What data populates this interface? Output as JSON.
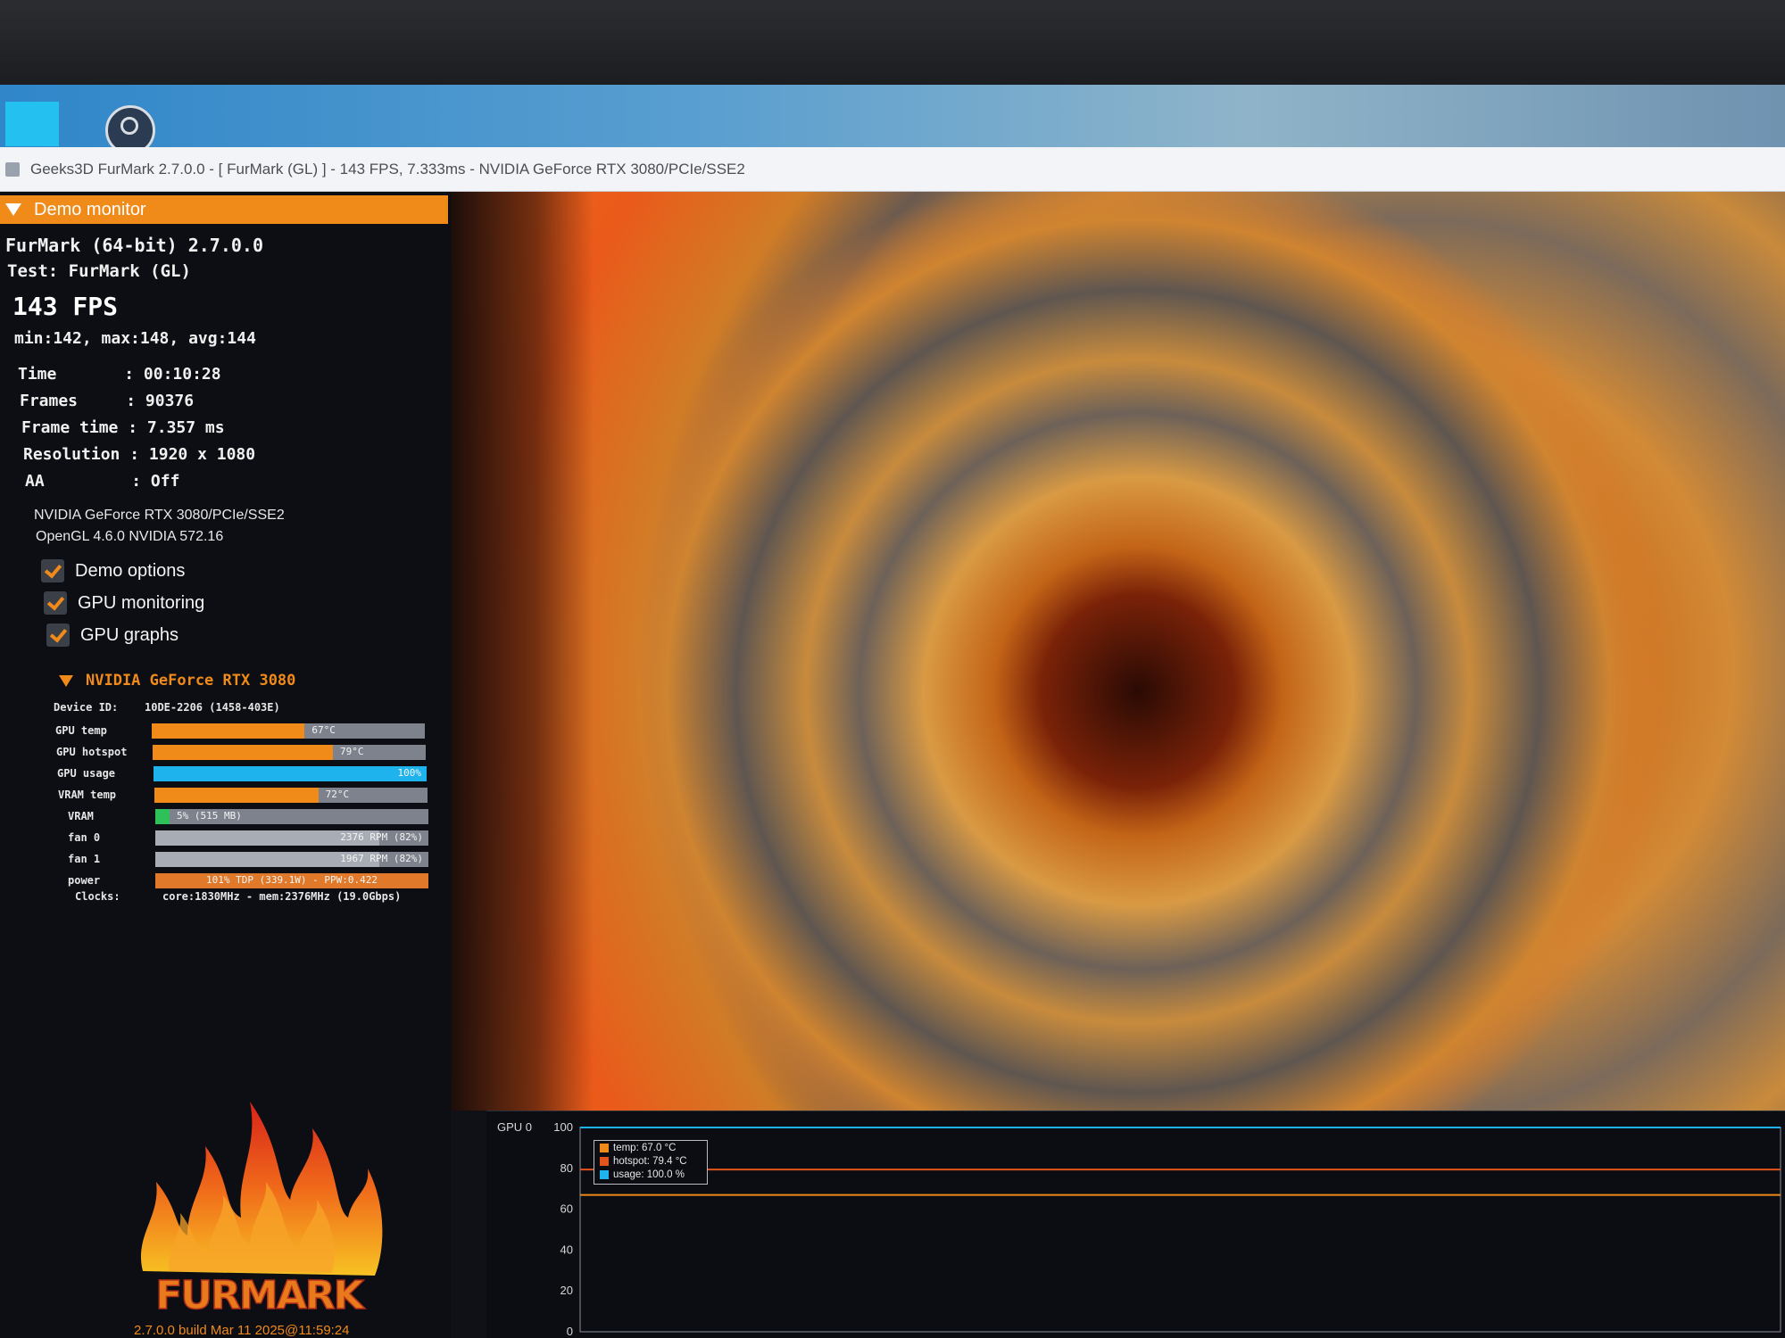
{
  "window": {
    "title": "Geeks3D FurMark 2.7.0.0 - [ FurMark (GL) ] - 143 FPS, 7.333ms - NVIDIA GeForce RTX 3080/PCIe/SSE2"
  },
  "panel": {
    "header": "Demo monitor",
    "app_line": "FurMark (64-bit) 2.7.0.0",
    "test_line": "Test: FurMark (GL)",
    "fps": "143 FPS",
    "fps_stats": "min:142, max:148, avg:144",
    "stats": [
      {
        "label": "Time      ",
        "value": ": 00:10:28"
      },
      {
        "label": "Frames    ",
        "value": ": 90376"
      },
      {
        "label": "Frame time",
        "value": ": 7.357 ms"
      },
      {
        "label": "Resolution",
        "value": ": 1920 x 1080"
      },
      {
        "label": "AA        ",
        "value": ": Off"
      }
    ],
    "gpu_renderer": "NVIDIA GeForce RTX 3080/PCIe/SSE2",
    "gl_version": "OpenGL 4.6.0 NVIDIA 572.16",
    "checkboxes": [
      {
        "label": "Demo options",
        "checked": true
      },
      {
        "label": "GPU monitoring",
        "checked": true
      },
      {
        "label": "GPU graphs",
        "checked": true
      }
    ],
    "gpu_name": "NVIDIA GeForce RTX 3080",
    "device_label": "Device ID:",
    "device_id": "10DE-2206 (1458-403E)",
    "metrics": [
      {
        "key": "GPU temp",
        "text": "67°C",
        "fill": 0.56,
        "color": "#f08a19"
      },
      {
        "key": "GPU hotspot",
        "text": "79°C",
        "fill": 0.66,
        "color": "#f08a19"
      },
      {
        "key": "GPU usage",
        "text": "100%",
        "fill": 1.0,
        "color": "#1fb3ee"
      },
      {
        "key": "VRAM temp",
        "text": "72°C",
        "fill": 0.6,
        "color": "#f08a19"
      },
      {
        "key": "VRAM",
        "text": "5% (515 MB)",
        "fill": 0.05,
        "color": "#2ec15a"
      },
      {
        "key": "fan 0",
        "text": "2376 RPM (82%)",
        "fill": 0.82,
        "color": "#a8adb5"
      },
      {
        "key": "fan 1",
        "text": "1967 RPM (82%)",
        "fill": 0.82,
        "color": "#a8adb5"
      },
      {
        "key": "power",
        "text": "101% TDP (339.1W) - PPW:0.422",
        "fill": 1.0,
        "color": "#e07a2a"
      }
    ],
    "clocks_label": "Clocks:",
    "clocks_value": "core:1830MHz - mem:2376MHz (19.0Gbps)",
    "logo_text": "FURMARK",
    "build": "2.7.0.0 build Mar 11 2025@11:59:24"
  },
  "graph": {
    "title": "GPU 0",
    "legend": [
      {
        "label": "temp: 67.0 °C",
        "color": "#f08a19"
      },
      {
        "label": "hotspot: 79.4 °C",
        "color": "#e2541c"
      },
      {
        "label": "usage: 100.0 %",
        "color": "#1fb3ee"
      }
    ]
  },
  "chart_data": {
    "type": "line",
    "title": "GPU 0",
    "ylim": [
      0,
      100
    ],
    "yticks": [
      100,
      80,
      60,
      40,
      20,
      0
    ],
    "series": [
      {
        "name": "temp: 67.0 °C",
        "color": "#f08a19",
        "values": [
          67,
          67,
          67,
          67,
          67,
          67
        ]
      },
      {
        "name": "hotspot: 79.4 °C",
        "color": "#e2541c",
        "values": [
          79.4,
          79.4,
          79.4,
          79.4,
          79.4,
          79.4
        ]
      },
      {
        "name": "usage: 100.0 %",
        "color": "#1fb3ee",
        "values": [
          100,
          100,
          100,
          100,
          100,
          100
        ]
      }
    ]
  }
}
